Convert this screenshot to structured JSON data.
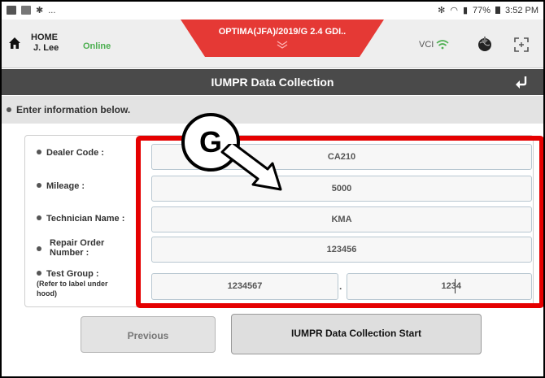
{
  "status_bar": {
    "left_text": "...",
    "right_text": "77%",
    "time": "3:52 PM"
  },
  "header": {
    "home_label": "HOME",
    "user_name": "J. Lee",
    "connection_status": "Online",
    "vehicle": "OPTIMA(JFA)/2019/G 2.4 GDI..",
    "vci_label": "VCI"
  },
  "title": "IUMPR Data Collection",
  "instruction": "Enter information below.",
  "form": {
    "dealer_code_label": "Dealer Code :",
    "dealer_code_value": "CA210",
    "mileage_label": "Mileage :",
    "mileage_value": "5000",
    "technician_label": "Technician Name :",
    "technician_value": "KMA",
    "repair_order_label_1": "Repair Order",
    "repair_order_label_2": "Number :",
    "repair_order_value": "123456",
    "test_group_label": "Test Group :",
    "test_group_note_1": "(Refer to label under",
    "test_group_note_2": "hood)",
    "test_group_value_1": "1234567",
    "test_group_separator": ".",
    "test_group_value_2": "1234"
  },
  "callout_letter": "G",
  "buttons": {
    "previous": "Previous",
    "start": "IUMPR Data Collection Start"
  },
  "colors": {
    "accent_red": "#e53935",
    "highlight_red": "#e50000",
    "online_green": "#4caf50",
    "title_bar": "#4a4a4a"
  }
}
